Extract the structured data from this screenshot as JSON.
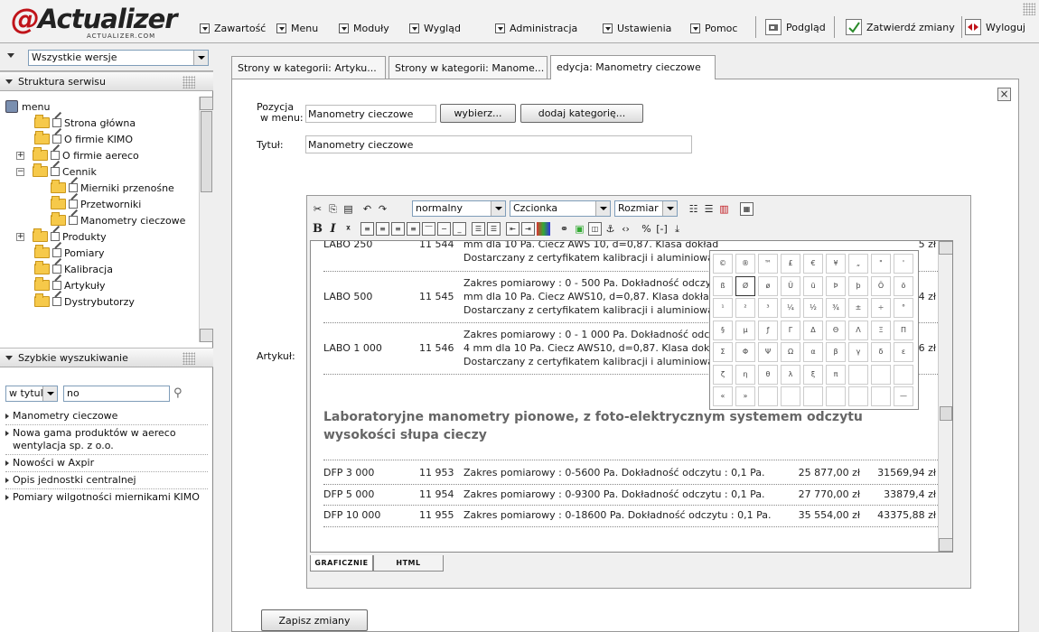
{
  "logo": {
    "text": "Actualizer",
    "sub": "ACTUALIZER.COM"
  },
  "menu": [
    "Zawartość",
    "Menu",
    "Moduły",
    "Wygląd",
    "Administracja",
    "Ustawienia",
    "Pomoc"
  ],
  "toolbar": {
    "preview": "Podgląd",
    "approve": "Zatwierdź zmiany",
    "logout": "Wyloguj"
  },
  "sidebar": {
    "version_select": "Wszystkie wersje",
    "structure_title": "Struktura serwisu",
    "tree": [
      {
        "label": "menu"
      },
      {
        "label": "Strona główna"
      },
      {
        "label": "O firmie KIMO"
      },
      {
        "label": "O firmie aereco"
      },
      {
        "label": "Cennik"
      },
      {
        "label": "Mierniki przenośne"
      },
      {
        "label": "Przetworniki"
      },
      {
        "label": "Manometry cieczowe"
      },
      {
        "label": "Produkty"
      },
      {
        "label": "Pomiary"
      },
      {
        "label": "Kalibracja"
      },
      {
        "label": "Artykuły"
      },
      {
        "label": "Dystrybutorzy"
      }
    ],
    "quick_title": "Szybkie wyszukiwanie",
    "search_scope": "w tytule",
    "search_value": "no",
    "results": [
      "Manometry cieczowe",
      "Nowa gama produktów w aereco wentylacja sp. z o.o.",
      "Nowości w Axpir",
      "Opis jednostki centralnej",
      "Pomiary wilgotności miernikami KIMO"
    ]
  },
  "tabs": [
    "Strony w kategorii: Artyku...",
    "Strony w kategorii: Manome...",
    "edycja: Manometry cieczowe"
  ],
  "form": {
    "position_label_1": "Pozycja",
    "position_label_2": "w menu:",
    "position_value": "Manometry cieczowe",
    "choose_btn": "wybierz...",
    "add_cat_btn": "dodaj kategorię...",
    "title_label": "Tytuł:",
    "title_value": "Manometry cieczowe",
    "article_label": "Artykuł:",
    "save_btn": "Zapisz zmiany"
  },
  "editor": {
    "format": "normalny",
    "font": "Czcionka",
    "size": "Rozmiar",
    "tab_visual": "GRAFICZNIE",
    "tab_html": "HTML",
    "rows_top": [
      {
        "c1": "LABO 250",
        "c2": "11 544",
        "l1": "mm dla 10 Pa. Ciecz AWS 10, d=0,87. Klasa dokład",
        "l2": "Dostarczany z certyfikatem kalibracji i aluminiową",
        "p": "5 zł"
      },
      {
        "c1": "LABO 500",
        "c2": "11 545",
        "l0": "Zakres pomiarowy : 0 - 500 Pa. Dokładność odczy",
        "l1": "mm dla 10 Pa. Ciecz AWS10, d=0,87. Klasa dokład",
        "l2": "Dostarczany z certyfikatem kalibracji i aluminiową",
        "p": "4 zł"
      },
      {
        "c1": "LABO 1 000",
        "c2": "11 546",
        "l0": "Zakres pomiarowy : 0 - 1 000 Pa. Dokładność odc",
        "l1": "4 mm dla 10 Pa. Ciecz AWS10, d=0,87. Klasa dokła",
        "l2": "Dostarczany z certyfikatem kalibracji i aluminiową",
        "p": "6 zł"
      }
    ],
    "heading": "Laboratoryjne manometry pionowe, z foto-elektrycznym systemem odczytu wysokości słupa cieczy",
    "rows_bottom": [
      {
        "c1": "DFP 3 000",
        "c2": "11 953",
        "c3": "Zakres pomiarowy : 0-5600 Pa. Dokładność odczytu : 0,1 Pa.",
        "c4": "25 877,00 zł",
        "c5": "31569,94 zł"
      },
      {
        "c1": "DFP 5 000",
        "c2": "11 954",
        "c3": "Zakres pomiarowy : 0-9300 Pa. Dokładność odczytu : 0,1 Pa.",
        "c4": "27 770,00 zł",
        "c5": "33879,4 zł"
      },
      {
        "c1": "DFP 10 000",
        "c2": "11 955",
        "c3": "Zakres pomiarowy : 0-18600 Pa. Dokładność odczytu : 0,1 Pa.",
        "c4": "35 554,00 zł",
        "c5": "43375,88 zł"
      }
    ]
  },
  "charmap": [
    [
      "©",
      "®",
      "™",
      "£",
      "€",
      "¥",
      "„",
      "\"",
      "'"
    ],
    [
      "ß",
      "Ø",
      "ø",
      "Ü",
      "ü",
      "Þ",
      "þ",
      "Ö",
      "ö"
    ],
    [
      "¹",
      "²",
      "³",
      "¼",
      "½",
      "¾",
      "±",
      "÷",
      "°"
    ],
    [
      "§",
      "µ",
      "ƒ",
      "Γ",
      "Δ",
      "Θ",
      "Λ",
      "Ξ",
      "Π"
    ],
    [
      "Σ",
      "Φ",
      "Ψ",
      "Ω",
      "α",
      "β",
      "γ",
      "δ",
      "ε"
    ],
    [
      "ζ",
      "η",
      "θ",
      "λ",
      "ξ",
      "π",
      "",
      "",
      ""
    ],
    [
      "«",
      "»",
      "",
      "",
      "",
      "",
      "",
      "",
      "—"
    ]
  ]
}
